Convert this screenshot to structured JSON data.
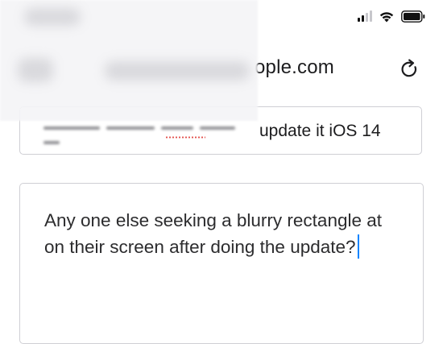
{
  "browser": {
    "url_visible_fragment": "ople.com",
    "reload_icon": "reload-icon"
  },
  "status": {
    "signal_bars": 4,
    "signal_active_bars": 2,
    "icons": [
      "cellular-signal-icon",
      "wifi-icon",
      "battery-icon"
    ]
  },
  "form": {
    "title_visible_text": "update it iOS 14",
    "body_text": "Any one else seeking a blurry rectangle at on their screen after doing the update?"
  },
  "colors": {
    "caret": "#0a84ff",
    "field_border": "#cfcfd4",
    "spellcheck_underline": "#e0403a"
  }
}
